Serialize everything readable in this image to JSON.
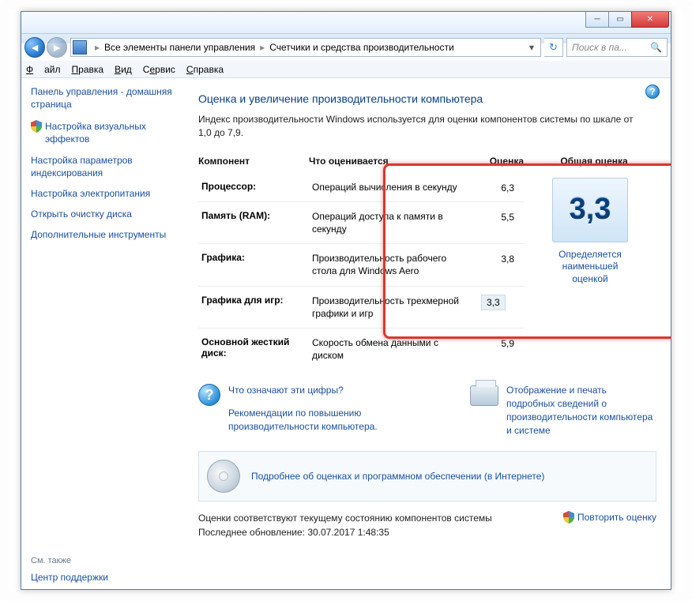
{
  "breadcrumb": {
    "level1": "Все элементы панели управления",
    "level2": "Счетчики и средства производительности"
  },
  "search": {
    "placeholder": "Поиск в па..."
  },
  "menu": {
    "file": "Файл",
    "edit": "Правка",
    "view": "Вид",
    "tools": "Сервис",
    "help": "Справка"
  },
  "sidebar": {
    "home": "Панель управления - домашняя страница",
    "items": [
      "Настройка визуальных эффектов",
      "Настройка параметров индексирования",
      "Настройка электропитания",
      "Открыть очистку диска",
      "Дополнительные инструменты"
    ],
    "seeAlsoTitle": "См. также",
    "seeAlso": "Центр поддержки"
  },
  "page": {
    "title": "Оценка и увеличение производительности компьютера",
    "desc": "Индекс производительности Windows используется для оценки компонентов системы по шкале от 1,0 до 7,9."
  },
  "table": {
    "h_comp": "Компонент",
    "h_desc": "Что оценивается",
    "h_sub": "Оценка",
    "h_base": "Общая оценка",
    "rows": [
      {
        "name": "Процессор:",
        "desc": "Операций вычисления в секунду",
        "score": "6,3"
      },
      {
        "name": "Память (RAM):",
        "desc": "Операций доступа к памяти в секунду",
        "score": "5,5"
      },
      {
        "name": "Графика:",
        "desc": "Производительность рабочего стола для Windows Aero",
        "score": "3,8"
      },
      {
        "name": "Графика для игр:",
        "desc": "Производительность трехмерной графики и игр",
        "score": "3,3"
      },
      {
        "name": "Основной жесткий диск:",
        "desc": "Скорость обмена данными с диском",
        "score": "5,9"
      }
    ],
    "baseScore": "3,3",
    "baseCaption": "Определяется наименьшей оценкой"
  },
  "links": {
    "whatNumbers": "Что означают эти цифры?",
    "tips": "Рекомендации по повышению производительности компьютера.",
    "printDetail": "Отображение и печать подробных сведений о производительности компьютера и системе",
    "learnMore": "Подробнее об оценках и программном обеспечении (в Интернете)"
  },
  "status": {
    "line1": "Оценки соответствуют текущему состоянию компонентов системы",
    "line2": "Последнее обновление: 30.07.2017 1:48:35",
    "rerun": "Повторить оценку"
  },
  "chart_data": {
    "type": "table",
    "title": "Индекс производительности Windows",
    "columns": [
      "Компонент",
      "Что оценивается",
      "Оценка"
    ],
    "rows": [
      [
        "Процессор",
        "Операций вычисления в секунду",
        6.3
      ],
      [
        "Память (RAM)",
        "Операций доступа к памяти в секунду",
        5.5
      ],
      [
        "Графика",
        "Производительность рабочего стола для Windows Aero",
        3.8
      ],
      [
        "Графика для игр",
        "Производительность трехмерной графики и игр",
        3.3
      ],
      [
        "Основной жесткий диск",
        "Скорость обмена данными с диском",
        5.9
      ]
    ],
    "base_score": 3.3,
    "scale": [
      1.0,
      7.9
    ]
  }
}
